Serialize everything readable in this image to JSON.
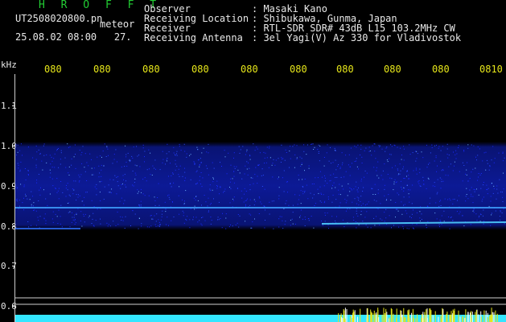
{
  "header": {
    "app_title": "H R O F F T",
    "file_name": "UT2508020800.pn",
    "mode": "meteor",
    "date_time": "25.08.02 08:00",
    "gain": "27."
  },
  "station": [
    {
      "label": "Observer",
      "value": ": Masaki Kano"
    },
    {
      "label": "Receiving Location",
      "value": ": Shibukawa, Gunma, Japan"
    },
    {
      "label": "Receiver",
      "value": ": RTL-SDR SDR# 43dB L15 103.2MHz CW"
    },
    {
      "label": "Receiving Antenna",
      "value": ": 3el Yagi(V) Az 330 for Vladivostok"
    }
  ],
  "axis": {
    "unit": "kHz",
    "y_ticks": [
      "1.1",
      "1.0",
      "0.9",
      "0.8",
      "0.7",
      "0.6"
    ],
    "x_ticks": [
      "080",
      "080",
      "080",
      "080",
      "080",
      "080",
      "080",
      "080",
      "080",
      "0810"
    ]
  },
  "colors": {
    "background": "#000000",
    "header_green": "#22cc33",
    "tick_yellow": "#e6e61a",
    "noise_blue": "#1a2cff",
    "trace_cyan": "#33e6ff"
  }
}
